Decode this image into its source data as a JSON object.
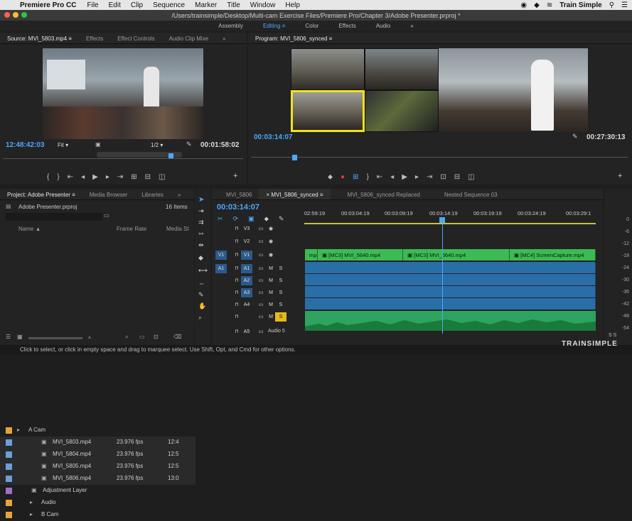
{
  "menubar": {
    "app_name": "Premiere Pro CC",
    "items": [
      "File",
      "Edit",
      "Clip",
      "Sequence",
      "Marker",
      "Title",
      "Window",
      "Help"
    ],
    "right_user": "Train Simple"
  },
  "window_title": "/Users/trainsimple/Desktop/Multi-cam Exercise Files/Premiere Pro/Chapter 3/Adobe Presenter.prproj *",
  "workspaces": [
    "Assembly",
    "Editing",
    "Color",
    "Effects",
    "Audio"
  ],
  "source_panel": {
    "tabs": [
      "Source: MVI_5803.mp4",
      "Effects",
      "Effect Controls",
      "Audio Clip Mixe"
    ],
    "timecode": "12:48:42:03",
    "fit": "Fit",
    "resolution": "1/2",
    "duration": "00:01:58:02"
  },
  "program_panel": {
    "tab": "Program: MVI_5806_synced",
    "timecode": "00:03:14:07",
    "duration": "00:27:30:13"
  },
  "project_panel": {
    "tabs": [
      "Project: Adobe Presenter",
      "Media Browser",
      "Libraries"
    ],
    "project_file": "Adobe Presenter.prproj",
    "item_count": "16 Items",
    "columns": [
      "Name",
      "Frame Rate",
      "Media St"
    ],
    "rows": [
      {
        "name": "A Cam",
        "rate": "",
        "start": "",
        "color": "#e8a33a"
      },
      {
        "name": "MVI_5803.mp4",
        "rate": "23.976 fps",
        "start": "12:4",
        "color": "#6a9fd8"
      },
      {
        "name": "MVI_5804.mp4",
        "rate": "23.976 fps",
        "start": "12:5",
        "color": "#6a9fd8"
      },
      {
        "name": "MVI_5805.mp4",
        "rate": "23.976 fps",
        "start": "12:5",
        "color": "#6a9fd8"
      },
      {
        "name": "MVI_5806.mp4",
        "rate": "23.976 fps",
        "start": "13:0",
        "color": "#6a9fd8"
      },
      {
        "name": "Adjustment Layer",
        "rate": "",
        "start": "",
        "color": "#a070c8"
      },
      {
        "name": "Audio",
        "rate": "",
        "start": "",
        "color": "#e8a33a"
      },
      {
        "name": "B Cam",
        "rate": "",
        "start": "",
        "color": "#e8a33a"
      }
    ]
  },
  "timeline": {
    "tabs": [
      "MVI_5806",
      "MVI_5806_synced",
      "MVI_5806_synced Replaced",
      "Nested Sequence 03"
    ],
    "timecode": "00:03:14:07",
    "ruler": [
      "02:59:19",
      "00:03:04:19",
      "00:03:09:19",
      "00:03:14:19",
      "00:03:19:19",
      "00:03:24:19",
      "00:03:29:1"
    ],
    "video_clips": [
      "mp4",
      "[MC3] MVI_5640.mp4",
      "[MC3] MVI_5640.mp4",
      "[MC4] ScreenCapture.mp4"
    ],
    "tracks": [
      {
        "left": "",
        "id": "V3",
        "m": "",
        "s": ""
      },
      {
        "left": "",
        "id": "V2",
        "m": "",
        "s": ""
      },
      {
        "left": "V1",
        "id": "V1",
        "m": "",
        "s": ""
      },
      {
        "left": "A1",
        "id": "A1",
        "m": "M",
        "s": "S"
      },
      {
        "left": "",
        "id": "A2",
        "m": "M",
        "s": "S"
      },
      {
        "left": "",
        "id": "A3",
        "m": "M",
        "s": "S"
      },
      {
        "left": "",
        "id": "A4",
        "m": "M",
        "s": "S"
      },
      {
        "left": "",
        "id": "",
        "m": "M",
        "s": "S"
      },
      {
        "left": "",
        "id": "A5",
        "m": "Audio 5",
        "s": ""
      }
    ]
  },
  "meter_labels": [
    "0",
    "-6",
    "-12",
    "-18",
    "-24",
    "-30",
    "-36",
    "-42",
    "-48",
    "-54"
  ],
  "meter_footer": "S S",
  "status": "Click to select, or click in empty space and drag to marquee select. Use Shift, Opt, and Cmd for other options.",
  "watermark": "TRAINSIMPLE"
}
